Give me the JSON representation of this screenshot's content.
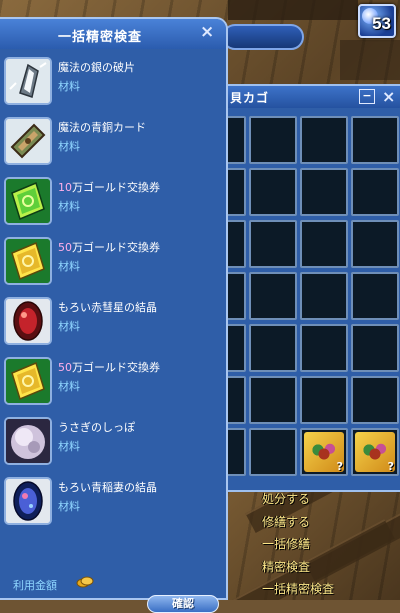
{
  "hud": {
    "level": "53"
  },
  "panel": {
    "title": "一括精密検査",
    "close_glyph": "×",
    "items": [
      {
        "name_hl": "",
        "name": "魔法の銀の破片",
        "type": "材料",
        "icon": "silver-shard-icon"
      },
      {
        "name_hl": "",
        "name": "魔法の青銅カード",
        "type": "材料",
        "icon": "bronze-card-icon"
      },
      {
        "name_hl": "10",
        "name": "万ゴールド交換券",
        "type": "材料",
        "icon": "green-ticket-icon"
      },
      {
        "name_hl": "50",
        "name": "万ゴールド交換券",
        "type": "材料",
        "icon": "gold-ticket-icon"
      },
      {
        "name_hl": "",
        "name": "もろい赤彗星の結晶",
        "type": "材料",
        "icon": "red-crystal-icon"
      },
      {
        "name_hl": "50",
        "name": "万ゴールド交換券",
        "type": "材料",
        "icon": "gold-ticket-icon"
      },
      {
        "name_hl": "",
        "name": "うさぎのしっぽ",
        "type": "材料",
        "icon": "rabbit-tail-icon"
      },
      {
        "name_hl": "",
        "name": "もろい青稲妻の結晶",
        "type": "材料",
        "icon": "blue-crystal-icon"
      }
    ],
    "fee_label": "利用金額",
    "confirm_label": "確認"
  },
  "basket": {
    "title": "貝カゴ",
    "minimize_glyph": "−",
    "close_glyph": "×"
  },
  "context_menu": [
    "処分する",
    "修繕する",
    "一括修繕",
    "精密検査",
    "一括精密検査"
  ],
  "colors": {
    "panel_bg": "#2f5ea8",
    "item_type": "#8fd6ff",
    "highlight": "#ffb0ea",
    "menu_text": "#ffe98a"
  }
}
